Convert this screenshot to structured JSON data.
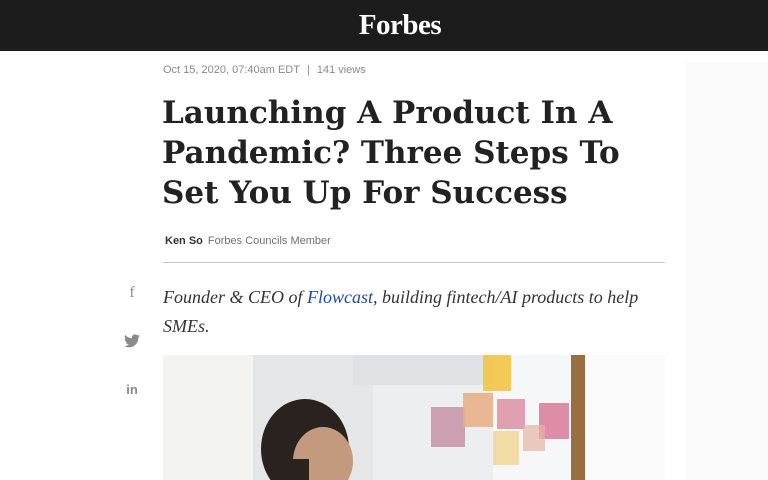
{
  "header": {
    "logo": "Forbes"
  },
  "article": {
    "date": "Oct 15, 2020, 07:40am EDT",
    "separator": "|",
    "views": "141 views",
    "title": "Launching A Product In A Pandemic? Three Steps To Set You Up For Success",
    "author": "Ken So",
    "author_role": "Forbes Councils Member",
    "bio": {
      "prefix": "Founder & CEO of ",
      "company": "Flowcast",
      "suffix": ", building fintech/AI products to help SMEs."
    }
  },
  "share": {
    "facebook_icon": "f",
    "twitter_icon": "twitter-bird",
    "linkedin_icon": "in"
  },
  "colors": {
    "topbar": "#1c1c1c",
    "link": "#1f4aa8",
    "text": "#222222"
  }
}
